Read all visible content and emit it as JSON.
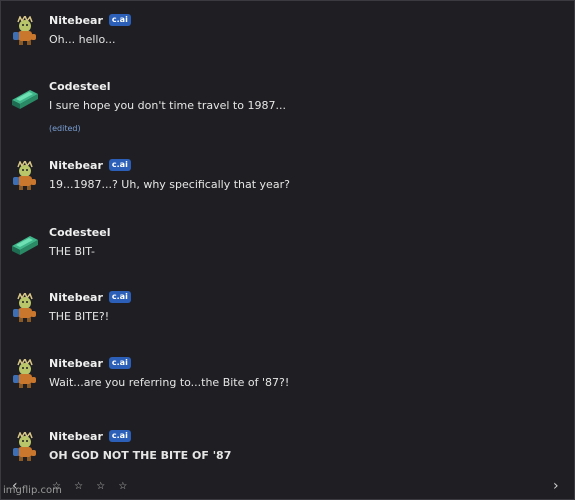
{
  "messages": [
    {
      "author": "Nitebear",
      "badge": "c.ai",
      "text": "Oh... hello...",
      "avatar": "bear-avatar-icon"
    },
    {
      "author": "Codesteel",
      "text": "I sure hope you don't time travel to 1987...",
      "edited": "(edited)",
      "avatar": "steel-ingot-avatar-icon"
    },
    {
      "author": "Nitebear",
      "badge": "c.ai",
      "text": "19...1987...? Uh, why specifically that year?",
      "avatar": "bear-avatar-icon"
    },
    {
      "author": "Codesteel",
      "text": "THE BIT-",
      "avatar": "steel-ingot-avatar-icon"
    },
    {
      "author": "Nitebear",
      "badge": "c.ai",
      "text": "THE BITE?!",
      "avatar": "bear-avatar-icon"
    },
    {
      "author": "Nitebear",
      "badge": "c.ai",
      "text": "Wait...are you referring to...the Bite of '87?!",
      "avatar": "bear-avatar-icon"
    },
    {
      "author": "Nitebear",
      "badge": "c.ai",
      "text": "OH GOD NOT THE BITE OF '87",
      "avatar": "bear-avatar-icon"
    }
  ],
  "footer": {
    "prev_icon": "‹",
    "next_icon": "›",
    "stars": "☆ ☆ ☆ ☆",
    "watermark": "imgflip.com"
  },
  "colors": {
    "background": "#1f1f23",
    "badge": "#2b5fb8",
    "edited": "#7a9fd6"
  }
}
